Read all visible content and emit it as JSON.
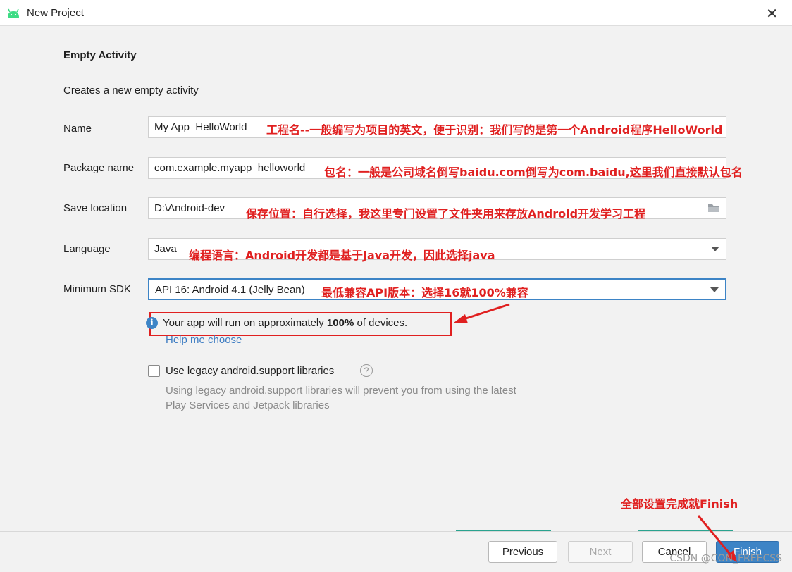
{
  "window": {
    "title": "New Project",
    "close_glyph": "✕",
    "app_icon": "android-icon"
  },
  "template": {
    "name": "Empty Activity",
    "description": "Creates a new empty activity"
  },
  "form": {
    "name": {
      "label": "Name",
      "value": "My App_HelloWorld",
      "annotation": "工程名--一般编写为项目的英文，便于识别：我们写的是第一个Android程序HelloWorld"
    },
    "package": {
      "label": "Package name",
      "value": "com.example.myapp_helloworld",
      "annotation": "包名：一般是公司域名倒写baidu.com倒写为com.baidu,这里我们直接默认包名"
    },
    "save_location": {
      "label": "Save location",
      "value": "D:\\Android-dev",
      "annotation": "保存位置：自行选择，我这里专门设置了文件夹用来存放Android开发学习工程",
      "icon": "folder-icon"
    },
    "language": {
      "label": "Language",
      "value": "Java",
      "annotation": "编程语言：Android开发都是基于Java开发，因此选择java"
    },
    "min_sdk": {
      "label": "Minimum SDK",
      "value": "API 16: Android 4.1 (Jelly Bean)",
      "annotation": "最低兼容API版本：选择16就100%兼容"
    }
  },
  "info": {
    "icon_glyph": "i",
    "text_before": "Your app will run on approximately ",
    "text_bold": "100%",
    "text_after": " of devices.",
    "help_link": "Help me choose"
  },
  "legacy": {
    "checked": false,
    "label": "Use legacy android.support libraries",
    "help_glyph": "?",
    "description": "Using legacy android.support libraries will prevent you from using the latest Play Services and Jetpack libraries"
  },
  "finish_annotation": "全部设置完成就Finish",
  "buttons": {
    "previous": "Previous",
    "next": "Next",
    "cancel": "Cancel",
    "finish": "Finish"
  },
  "watermark": "CSDN @CON_FREECSS",
  "colors": {
    "annotation": "#e02020",
    "accent": "#3d84c6",
    "link": "#3d7cc2"
  }
}
